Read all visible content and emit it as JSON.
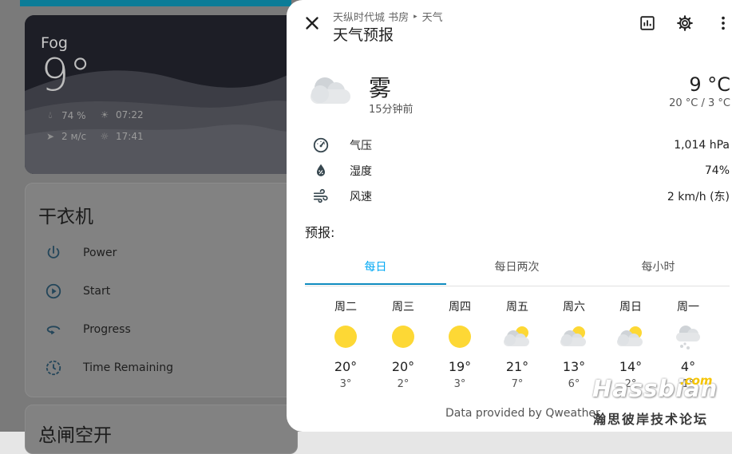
{
  "background": {
    "weather_card": {
      "condition": "Fog",
      "temperature": "9°",
      "humidity": "74 %",
      "sunrise": "07:22",
      "wind": "2 м/с",
      "sunset": "17:41"
    },
    "dryer_card": {
      "title": "干衣机",
      "rows": [
        {
          "label": "Power",
          "icon": "power-icon"
        },
        {
          "label": "Start",
          "icon": "play-pause-icon"
        },
        {
          "label": "Progress",
          "icon": "progress-icon"
        },
        {
          "label": "Time Remaining",
          "icon": "timer-icon"
        }
      ]
    },
    "second_card": {
      "title": "总闸空开"
    }
  },
  "dialog": {
    "breadcrumb": {
      "area": "天纵时代城 书房",
      "entity": "天气"
    },
    "title": "天气预报",
    "current": {
      "condition": "雾",
      "updated": "15分钟前",
      "temperature": "9 °C",
      "range": "20 °C / 3 °C"
    },
    "attributes": [
      {
        "label": "气压",
        "value": "1,014 hPa",
        "icon": "gauge-icon"
      },
      {
        "label": "湿度",
        "value": "74%",
        "icon": "water-percent-icon"
      },
      {
        "label": "风速",
        "value": "2 km/h (东)",
        "icon": "wind-icon"
      }
    ],
    "forecast_label": "预报:",
    "tabs": [
      {
        "label": "每日",
        "active": true
      },
      {
        "label": "每日两次",
        "active": false
      },
      {
        "label": "每小时",
        "active": false
      }
    ],
    "forecast": [
      {
        "day": "周二",
        "icon": "sunny",
        "high": "20°",
        "low": "3°"
      },
      {
        "day": "周三",
        "icon": "sunny",
        "high": "20°",
        "low": "2°"
      },
      {
        "day": "周四",
        "icon": "sunny",
        "high": "19°",
        "low": "3°"
      },
      {
        "day": "周五",
        "icon": "partly-cloudy",
        "high": "21°",
        "low": "7°"
      },
      {
        "day": "周六",
        "icon": "partly-cloudy",
        "high": "13°",
        "low": "6°"
      },
      {
        "day": "周日",
        "icon": "partly-cloudy",
        "high": "14°",
        "low": "2°"
      },
      {
        "day": "周一",
        "icon": "snowy-cloudy",
        "high": "4°",
        "low": "1°"
      }
    ],
    "attribution": "Data provided by Qweather"
  },
  "watermark": {
    "brand": "Hassbian",
    "tld": ".com",
    "tagline": "瀚思彼岸技术论坛"
  },
  "colors": {
    "accent": "#03a9f4",
    "tab_indicator": "#0e8bbf",
    "sun": "#fdd835",
    "cloud": "#cfd3d7"
  }
}
